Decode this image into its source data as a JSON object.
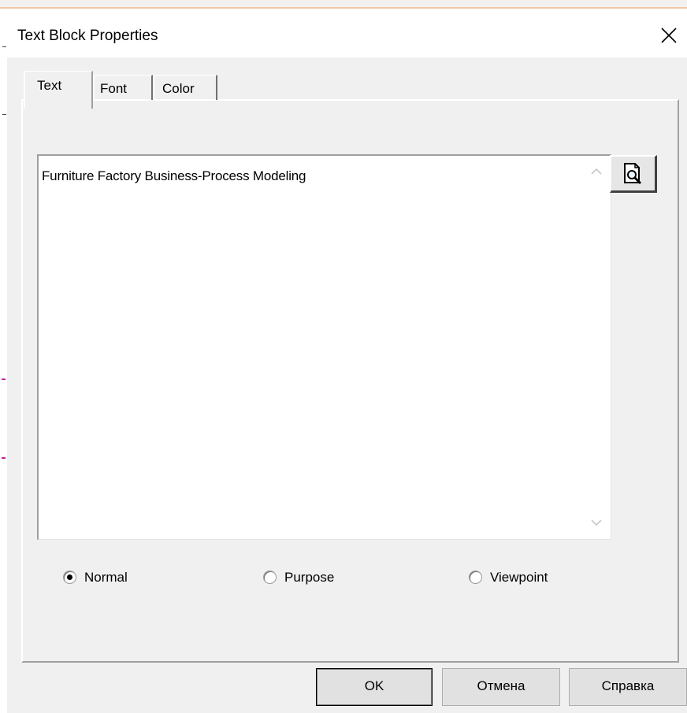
{
  "dialog": {
    "title": "Text Block Properties",
    "close_icon": "close-icon"
  },
  "tabs": [
    {
      "label": "Text",
      "selected": true
    },
    {
      "label": "Font",
      "selected": false
    },
    {
      "label": "Color",
      "selected": false
    }
  ],
  "text_block": {
    "value": "Furniture Factory Business-Process Modeling",
    "preview_icon": "print-preview-icon"
  },
  "style_options": [
    {
      "label": "Normal",
      "checked": true
    },
    {
      "label": "Purpose",
      "checked": false
    },
    {
      "label": "Viewpoint",
      "checked": false
    }
  ],
  "buttons": {
    "ok": "OK",
    "cancel": "Отмена",
    "help": "Справка"
  }
}
